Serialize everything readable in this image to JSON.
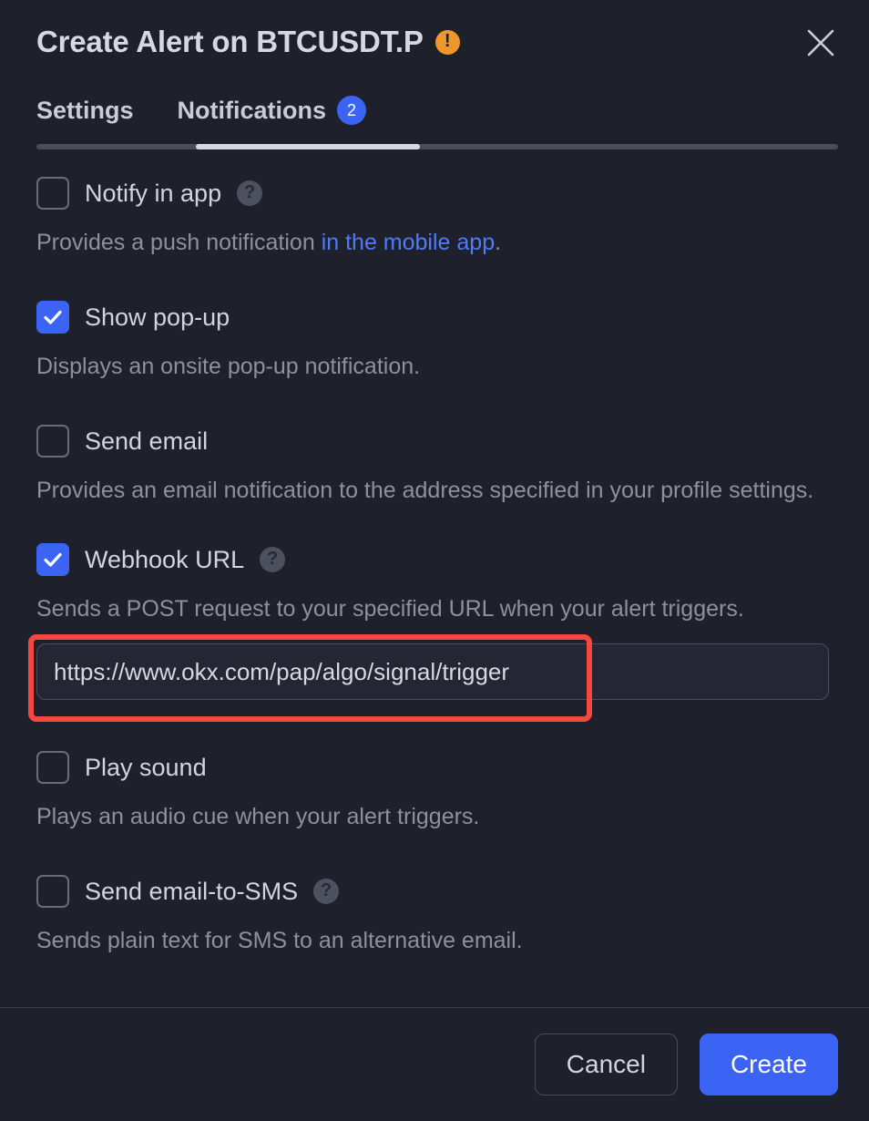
{
  "header": {
    "title": "Create Alert on BTCUSDT.P",
    "warning_icon": "warning-exclamation-icon",
    "close_icon": "close-icon"
  },
  "tabs": {
    "items": [
      {
        "label": "Settings",
        "active": false,
        "badge": null
      },
      {
        "label": "Notifications",
        "active": true,
        "badge": "2"
      }
    ]
  },
  "options": [
    {
      "label": "Notify in app",
      "checked": false,
      "help": "?",
      "desc_prefix": "Provides a push notification ",
      "desc_link": "in the mobile app",
      "desc_suffix": "."
    },
    {
      "label": "Show pop-up",
      "checked": true,
      "desc": "Displays an onsite pop-up notification."
    },
    {
      "label": "Send email",
      "checked": false,
      "desc": "Provides an email notification to the address specified in your profile settings."
    },
    {
      "label": "Webhook URL",
      "checked": true,
      "help": "?",
      "desc": "Sends a POST request to your specified URL when your alert triggers."
    },
    {
      "label": "Play sound",
      "checked": false,
      "desc": "Plays an audio cue when your alert triggers."
    },
    {
      "label": "Send email-to-SMS",
      "checked": false,
      "help": "?",
      "desc": "Sends plain text for SMS to an alternative email."
    }
  ],
  "webhook": {
    "value": "https://www.okx.com/pap/algo/signal/trigger",
    "placeholder": "Webhook URL"
  },
  "footer": {
    "cancel_label": "Cancel",
    "create_label": "Create"
  },
  "colors": {
    "background": "#1e212b",
    "accent_blue": "#3b64f5",
    "warning_orange": "#f0972b",
    "highlight_red": "#f4473f",
    "link_blue": "#4f7bf7"
  }
}
